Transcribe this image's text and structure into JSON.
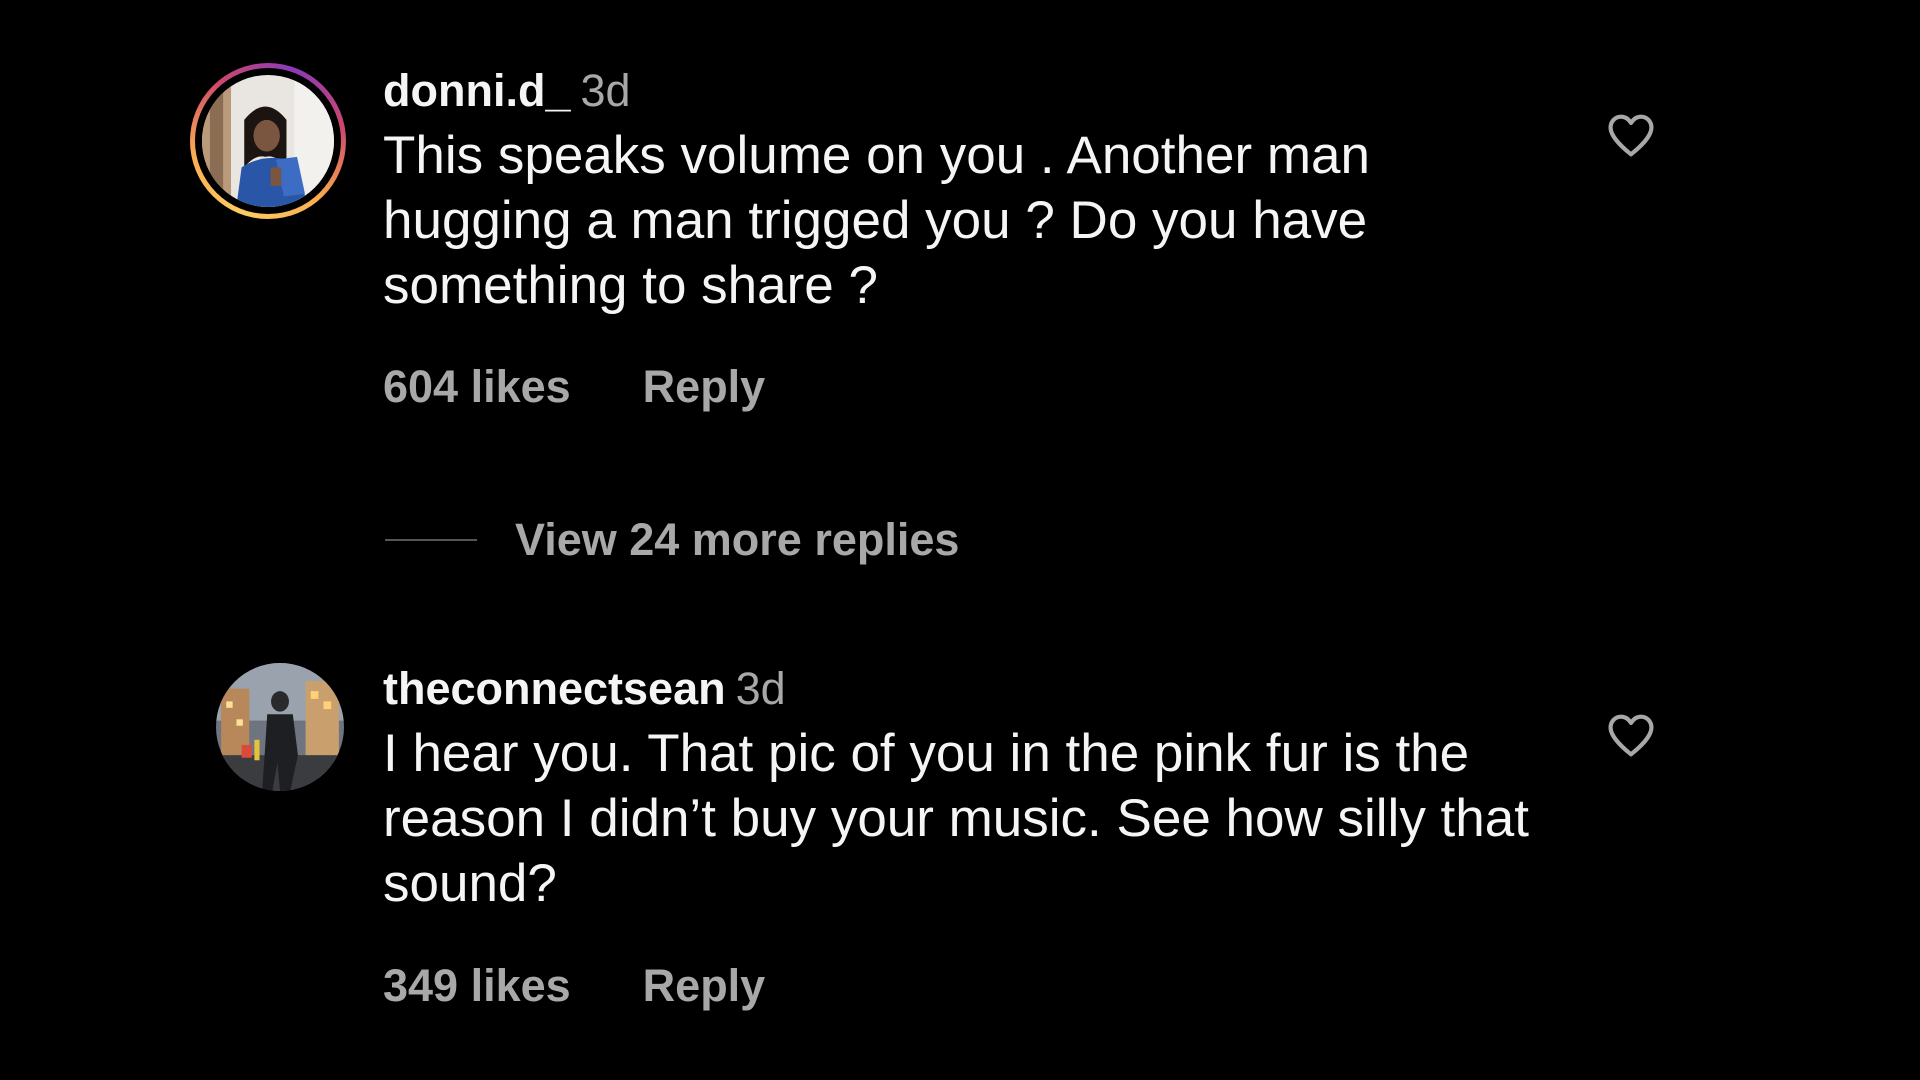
{
  "colors": {
    "background": "#000000",
    "primary_text": "#f5f5f5",
    "secondary_text": "#a8a8a8",
    "story_ring": [
      "#fccc63",
      "#fbad50",
      "#cd486b",
      "#8a3ab9"
    ]
  },
  "comments": [
    {
      "username": "donni.d_",
      "time": "3d",
      "text": "This speaks volume on you . Another man hugging a man trigged you ? Do you have something to share ?",
      "likes": "604 likes",
      "reply_label": "Reply",
      "has_story_ring": true,
      "like_icon": "heart-outline-icon"
    },
    {
      "username": "theconnectsean",
      "time": "3d",
      "text": "I hear you. That pic of you in the pink fur is the reason I didn’t buy your music. See how silly that sound?",
      "likes": "349 likes",
      "reply_label": "Reply",
      "has_story_ring": false,
      "like_icon": "heart-outline-icon"
    }
  ],
  "view_replies_label": "View 24 more replies"
}
